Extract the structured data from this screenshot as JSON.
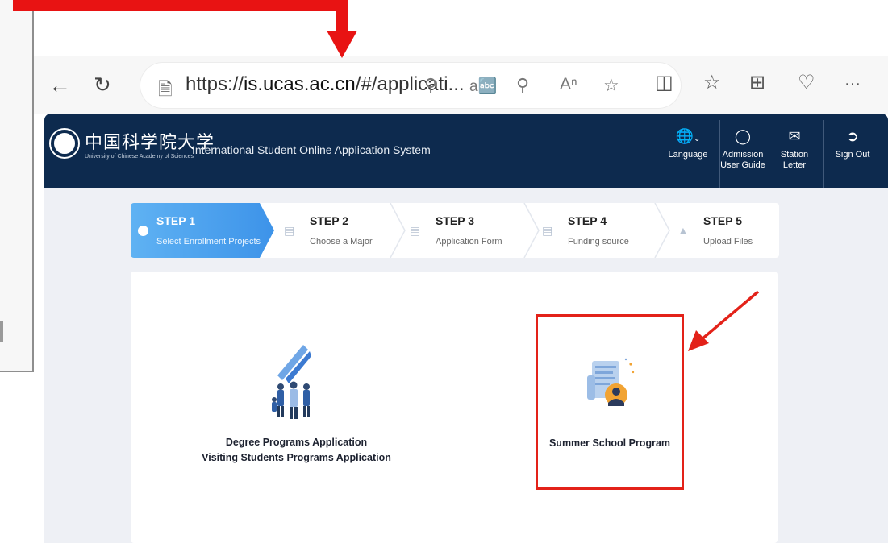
{
  "browser": {
    "url_prefix": "https://",
    "url_domain": "is.ucas.ac.cn",
    "url_rest": "/#/applicati...",
    "more_label": "···"
  },
  "app": {
    "logo_text": "中国科学院大学",
    "logo_subtitle": "University of Chinese Academy of Sciences",
    "system_title": "International Student Online Application System",
    "header_items": [
      {
        "label": "Language",
        "icon": "globe-icon"
      },
      {
        "label": "Admission User Guide",
        "icon": "compass-icon"
      },
      {
        "label": "Station Letter",
        "icon": "mail-icon"
      },
      {
        "label": "Sign Out",
        "icon": "sign-out-icon"
      }
    ]
  },
  "steps": [
    {
      "title": "STEP 1",
      "subtitle": "Select Enrollment Projects",
      "active": true
    },
    {
      "title": "STEP 2",
      "subtitle": "Choose a Major",
      "active": false
    },
    {
      "title": "STEP 3",
      "subtitle": "Application Form",
      "active": false
    },
    {
      "title": "STEP 4",
      "subtitle": "Funding source",
      "active": false
    },
    {
      "title": "STEP 5",
      "subtitle": "Upload Files",
      "active": false
    }
  ],
  "programs": [
    {
      "line1": "Degree Programs Application",
      "line2": "Visiting Students Programs Application",
      "icon": "people-chart-icon"
    },
    {
      "line1": "Summer School Program",
      "icon": "certificate-icon"
    }
  ],
  "colors": {
    "header_bg": "#0d2a4e",
    "step_active": "#3d93e9",
    "annotation_red": "#e81313"
  }
}
